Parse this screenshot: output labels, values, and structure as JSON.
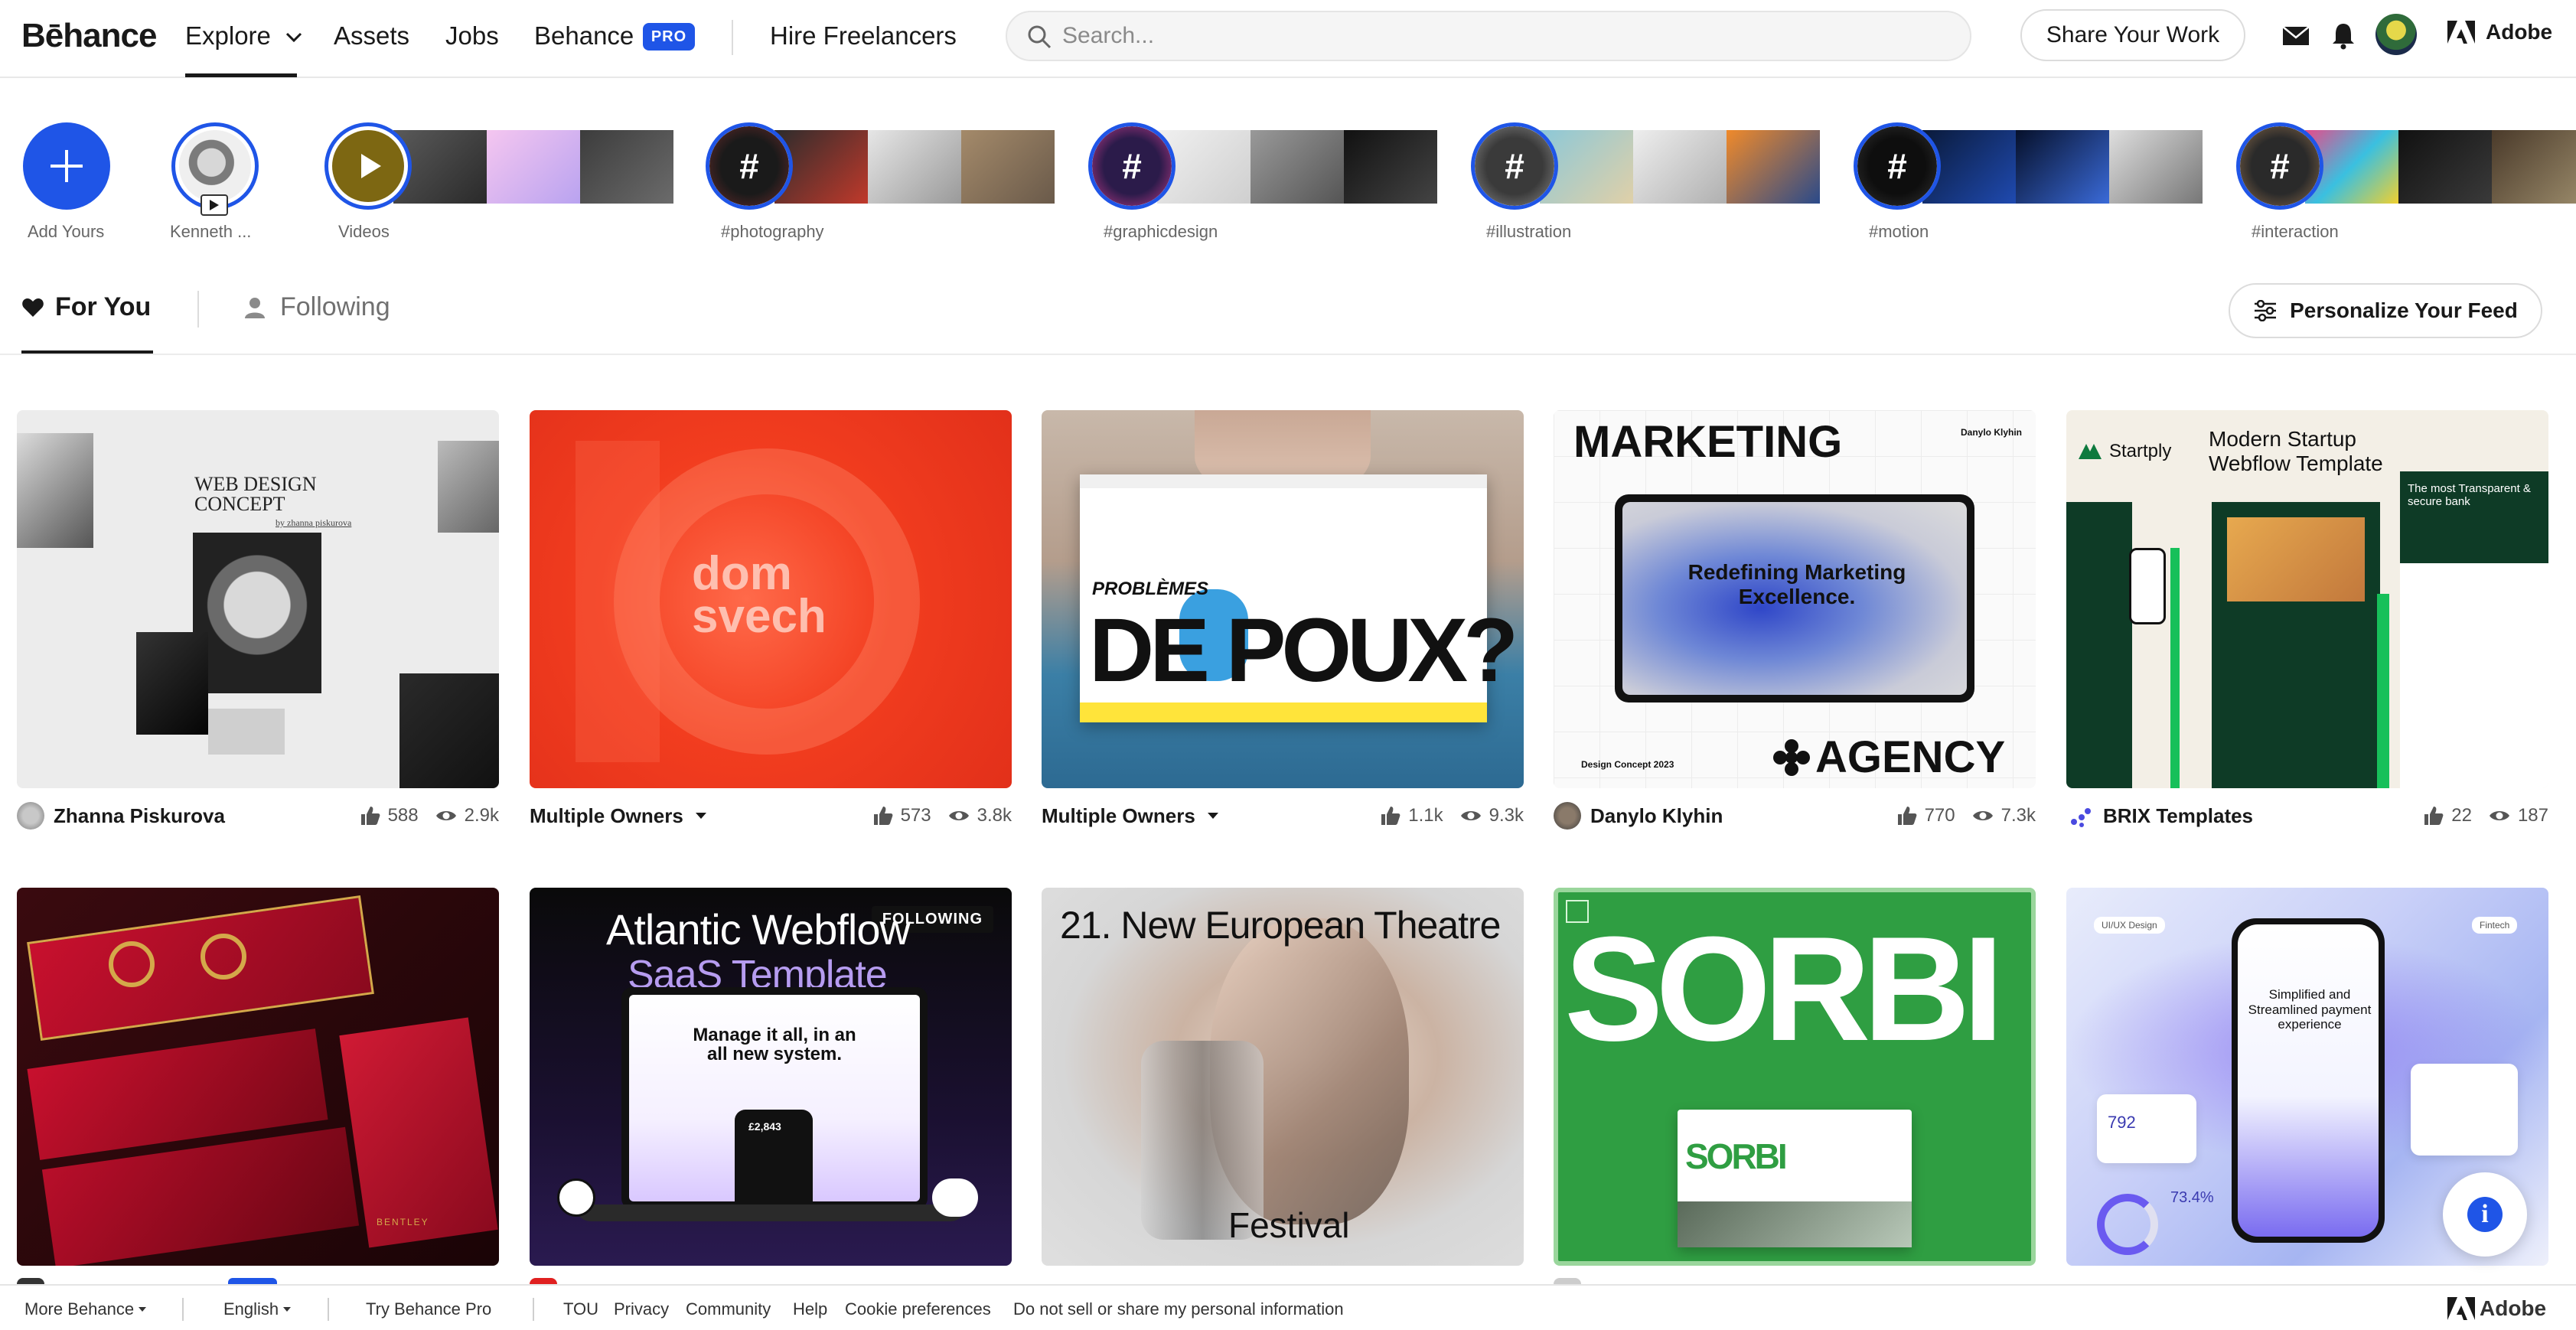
{
  "brand": {
    "logo": "Bēhance",
    "adobe_label": "Adobe",
    "accent": "#1f55e7"
  },
  "nav": {
    "explore": "Explore",
    "assets": "Assets",
    "jobs": "Jobs",
    "behance": "Behance",
    "pro_badge": "PRO",
    "hire": "Hire Freelancers",
    "share": "Share Your Work"
  },
  "search": {
    "placeholder": "Search..."
  },
  "stories": [
    {
      "label": "Add Yours"
    },
    {
      "label": "Kenneth ..."
    },
    {
      "label": "Videos"
    },
    {
      "label": "#photography"
    },
    {
      "label": "#graphicdesign"
    },
    {
      "label": "#illustration"
    },
    {
      "label": "#motion"
    },
    {
      "label": "#interaction"
    }
  ],
  "tabs": {
    "for_you": "For You",
    "following": "Following",
    "personalize": "Personalize Your Feed"
  },
  "projects": [
    {
      "owner": "Zhanna Piskurova",
      "likes": "588",
      "views": "2.9k",
      "art_title": "WEB DESIGN\nCONCEPT",
      "art_sub": "by zhanna piskurova"
    },
    {
      "owner": "Multiple Owners",
      "likes": "573",
      "views": "3.8k",
      "art_title": "dom\nsvech"
    },
    {
      "owner": "Multiple Owners",
      "likes": "1.1k",
      "views": "9.3k",
      "art_small": "PROBLÈMES",
      "art_title": "DE POUX?"
    },
    {
      "owner": "Danylo Klyhin",
      "likes": "770",
      "views": "7.3k",
      "art_top": "MARKETING",
      "art_author": "Danylo Klyhin",
      "art_mid": "Redefining Marketing Excellence.",
      "art_bottom": "AGENCY",
      "art_footer": "Design Concept 2023"
    },
    {
      "owner": "BRIX Templates",
      "likes": "22",
      "views": "187",
      "art_brand": "Startply",
      "art_title": "Modern Startup Webflow Template",
      "art_banner": "The most Transparent & secure bank"
    },
    {
      "art_title": "BENTLEY"
    },
    {
      "art_title": "Atlantic Webflow",
      "art_sub": "SaaS Template",
      "art_mid": "Manage it all, in an all new system.",
      "art_badge": "FOLLOWING",
      "art_price": "£2,843"
    },
    {
      "art_title": "21. New European Theatre",
      "art_bottom": "Festival"
    },
    {
      "art_title": "SORBI",
      "art_mid": "SORBI"
    },
    {
      "art_tag": "UI/UX Design",
      "art_tag2": "Fintech",
      "art_mid": "Simplified and Streamlined payment experience",
      "art_num": "792",
      "art_pct": "73.4%"
    }
  ],
  "footer": {
    "more": "More Behance",
    "lang": "English",
    "pro": "Try Behance Pro",
    "tou": "TOU",
    "privacy": "Privacy",
    "community": "Community",
    "help": "Help",
    "cookie": "Cookie preferences",
    "dnsell": "Do not sell or share my personal information",
    "adobe": "Adobe"
  }
}
